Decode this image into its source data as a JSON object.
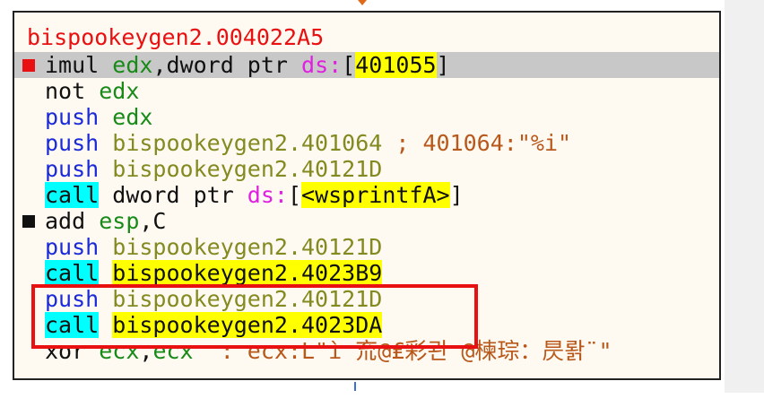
{
  "colors": {
    "address_red": "#e81010",
    "mnemonic_blue": "#1a2ad8",
    "register_green": "#188a18",
    "symbol_olive": "#838a20",
    "segment_magenta": "#e020e0",
    "comment_brown": "#b8581a",
    "highlight_yellow": "#ffff00",
    "highlight_cyan": "#00ffff",
    "selection_gray": "#c8c8c8"
  },
  "disasm": {
    "header": "bispookeygen2.004022A5",
    "lines": [
      {
        "mnemonic": "imul",
        "ops": [
          "edx",
          ",",
          "dword ptr ",
          "ds:",
          "[",
          "401055",
          "]"
        ],
        "marker": "breakpoint-icon"
      },
      {
        "mnemonic": "not",
        "ops": [
          "edx"
        ]
      },
      {
        "mnemonic": "push",
        "ops": [
          "edx"
        ]
      },
      {
        "mnemonic": "push",
        "ops": [
          "bispookeygen2.401064"
        ],
        "comment": "; 401064:\"%i\""
      },
      {
        "mnemonic": "push",
        "ops": [
          "bispookeygen2.40121D"
        ]
      },
      {
        "mnemonic": "call",
        "ops": [
          "dword ptr ",
          "ds:",
          "[",
          "<wsprintfA>",
          "]"
        ]
      },
      {
        "mnemonic": "add",
        "ops": [
          "esp",
          ",C"
        ],
        "marker": "bookmark-icon"
      },
      {
        "mnemonic": "push",
        "ops": [
          "bispookeygen2.40121D"
        ]
      },
      {
        "mnemonic": "call",
        "ops": [
          "bispookeygen2.4023B9"
        ]
      },
      {
        "mnemonic": "push",
        "ops": [
          "bispookeygen2.40121D"
        ]
      },
      {
        "mnemonic": "call",
        "ops": [
          "bispookeygen2.4023DA"
        ]
      },
      {
        "mnemonic": "xor",
        "ops": [
          "ecx",
          ",",
          "ecx"
        ],
        "comment": ": ecx:L\"ì 㐬@₤彩괸 @楝琮：昃뢁¨\""
      }
    ]
  }
}
